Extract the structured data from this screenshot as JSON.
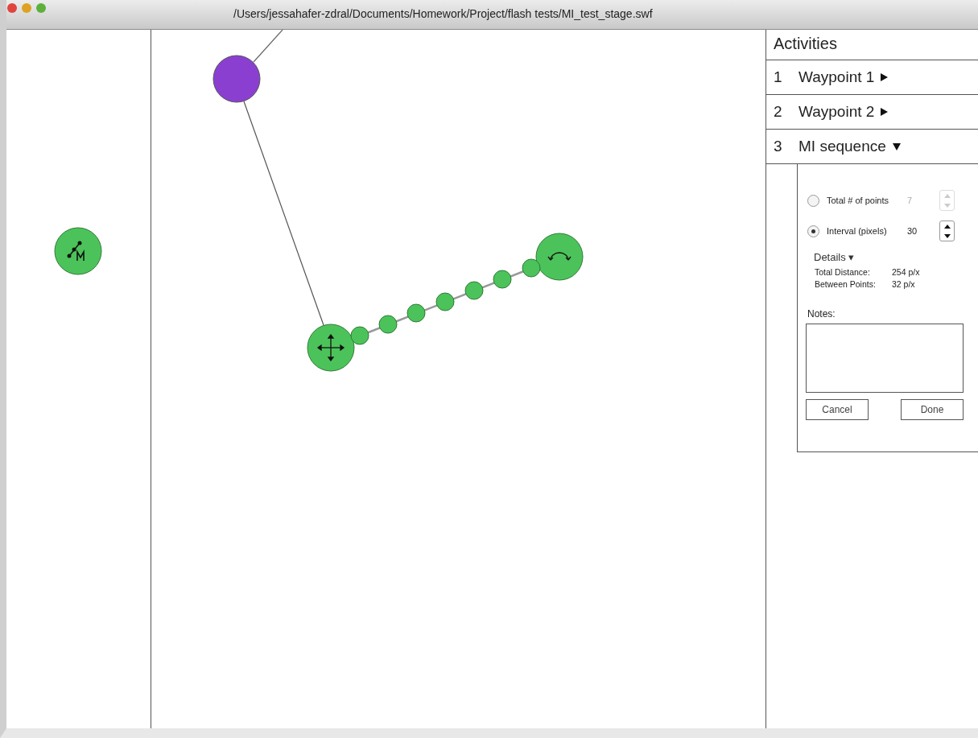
{
  "window": {
    "title": "/Users/jessahafer-zdral/Documents/Homework/Project/flash tests/MI_test_stage.swf"
  },
  "palette": [
    {
      "kind": "mi-tool",
      "color": "#4cc35a"
    }
  ],
  "canvas": {
    "nodes": [
      {
        "kind": "waypoint",
        "color": "#8a3fd1"
      },
      {
        "kind": "move",
        "color": "#4cc35a"
      },
      {
        "kind": "rotate",
        "color": "#4cc35a"
      },
      {
        "kind": "point",
        "color": "#4cc35a"
      },
      {
        "kind": "point",
        "color": "#4cc35a"
      },
      {
        "kind": "point",
        "color": "#4cc35a"
      },
      {
        "kind": "point",
        "color": "#4cc35a"
      },
      {
        "kind": "point",
        "color": "#4cc35a"
      },
      {
        "kind": "point",
        "color": "#4cc35a"
      },
      {
        "kind": "point",
        "color": "#4cc35a"
      }
    ]
  },
  "activities": {
    "title": "Activities",
    "items": [
      {
        "number": "1",
        "label": "Waypoint 1",
        "expanded": false
      },
      {
        "number": "2",
        "label": "Waypoint 2",
        "expanded": false
      },
      {
        "number": "3",
        "label": "MI sequence",
        "expanded": true
      }
    ]
  },
  "sequence": {
    "options": [
      {
        "label": "Total # of points",
        "value": "7",
        "selected": false,
        "disabled": true
      },
      {
        "label": "Interval (pixels)",
        "value": "30",
        "selected": true,
        "disabled": false
      }
    ],
    "details_label": "Details ▾",
    "stats": [
      {
        "label": "Total Distance:",
        "value": "254 p/x"
      },
      {
        "label": "Between Points:",
        "value": "32 p/x"
      }
    ],
    "notes_label": "Notes:",
    "buttons": [
      "Cancel",
      "Done"
    ]
  }
}
